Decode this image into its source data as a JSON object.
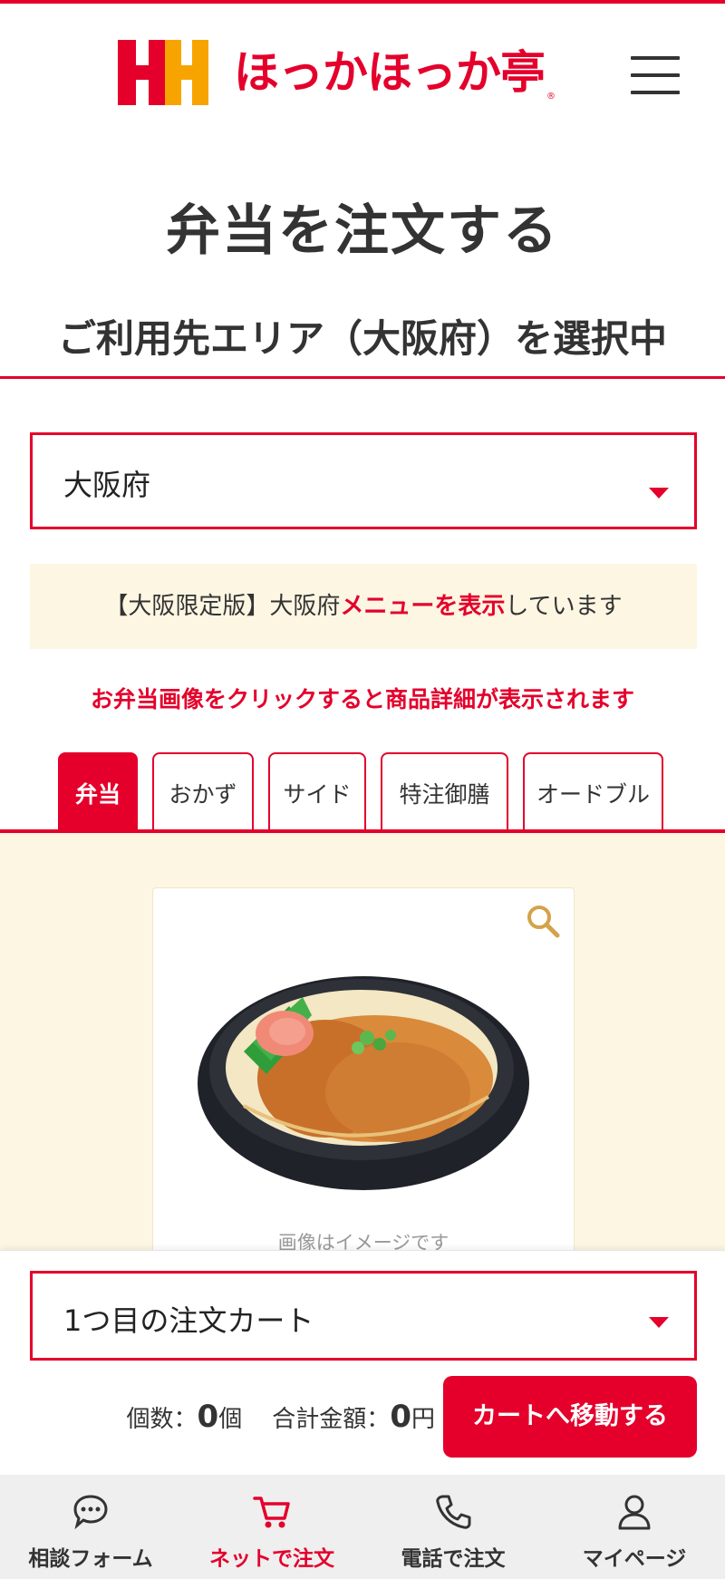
{
  "header": {
    "logo_text": "ほっかほっか亭",
    "logo_reg": "®",
    "menu_icon": "hamburger-menu-icon"
  },
  "page": {
    "title": "弁当を注文する",
    "area_title": "ご利用先エリア（大阪府）を選択中"
  },
  "area_select": {
    "value": "大阪府"
  },
  "notice": {
    "prefix": "【大阪限定版】大阪府",
    "highlight": "メニューを表示",
    "suffix": "しています"
  },
  "hint": "お弁当画像をクリックすると商品詳細が表示されます",
  "tabs": [
    {
      "label": "弁当",
      "active": true
    },
    {
      "label": "おかず",
      "active": false
    },
    {
      "label": "サイド",
      "active": false
    },
    {
      "label": "特注御膳",
      "active": false
    },
    {
      "label": "オードブル",
      "active": false
    }
  ],
  "product": {
    "image_caption": "画像はイメージです",
    "zoom_icon": "zoom-search-icon"
  },
  "cart": {
    "select_value": "1つ目の注文カート",
    "count_label": "個数：",
    "count_value": "0",
    "count_unit": "個",
    "total_label": "合計金額：",
    "total_value": "0",
    "total_unit": "円",
    "button_label": "カートへ移動する"
  },
  "bottom_nav": [
    {
      "label": "相談フォーム",
      "icon": "chat-bubble-icon",
      "active": false
    },
    {
      "label": "ネットで注文",
      "icon": "cart-icon",
      "active": true
    },
    {
      "label": "電話で注文",
      "icon": "phone-icon",
      "active": false
    },
    {
      "label": "マイページ",
      "icon": "user-icon",
      "active": false
    }
  ],
  "colors": {
    "accent": "#e4002b",
    "logo_orange": "#f7a400",
    "cream": "#fdf6e3"
  }
}
